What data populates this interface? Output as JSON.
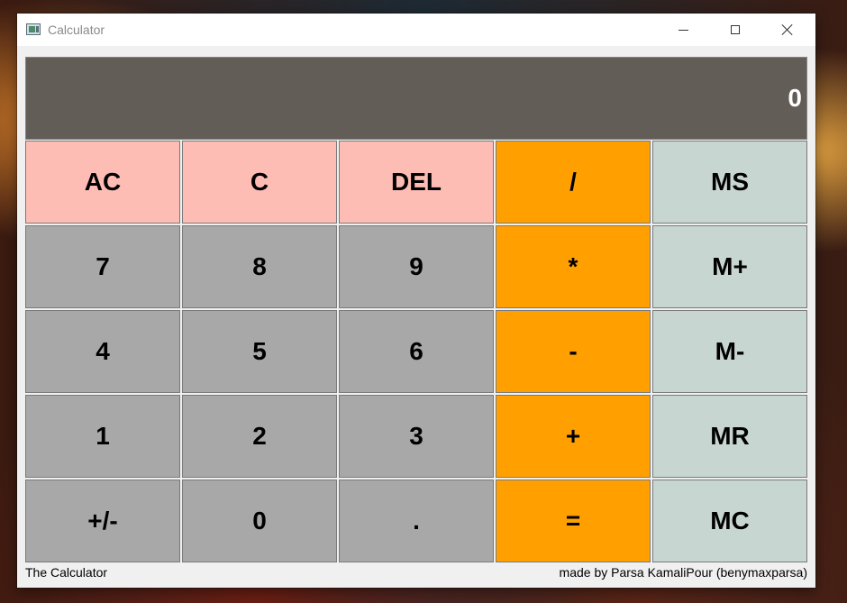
{
  "window": {
    "title": "Calculator"
  },
  "display": {
    "value": "0"
  },
  "keys": [
    {
      "label": "AC",
      "type": "clear",
      "name": "all-clear-button"
    },
    {
      "label": "C",
      "type": "clear",
      "name": "clear-button"
    },
    {
      "label": "DEL",
      "type": "clear",
      "name": "delete-button"
    },
    {
      "label": "/",
      "type": "op",
      "name": "divide-button"
    },
    {
      "label": "MS",
      "type": "mem",
      "name": "memory-store-button"
    },
    {
      "label": "7",
      "type": "num",
      "name": "digit-7-button"
    },
    {
      "label": "8",
      "type": "num",
      "name": "digit-8-button"
    },
    {
      "label": "9",
      "type": "num",
      "name": "digit-9-button"
    },
    {
      "label": "*",
      "type": "op",
      "name": "multiply-button"
    },
    {
      "label": "M+",
      "type": "mem",
      "name": "memory-add-button"
    },
    {
      "label": "4",
      "type": "num",
      "name": "digit-4-button"
    },
    {
      "label": "5",
      "type": "num",
      "name": "digit-5-button"
    },
    {
      "label": "6",
      "type": "num",
      "name": "digit-6-button"
    },
    {
      "label": "-",
      "type": "op",
      "name": "subtract-button"
    },
    {
      "label": "M-",
      "type": "mem",
      "name": "memory-subtract-button"
    },
    {
      "label": "1",
      "type": "num",
      "name": "digit-1-button"
    },
    {
      "label": "2",
      "type": "num",
      "name": "digit-2-button"
    },
    {
      "label": "3",
      "type": "num",
      "name": "digit-3-button"
    },
    {
      "label": "+",
      "type": "op",
      "name": "add-button"
    },
    {
      "label": "MR",
      "type": "mem",
      "name": "memory-recall-button"
    },
    {
      "label": "+/-",
      "type": "num",
      "name": "negate-button"
    },
    {
      "label": "0",
      "type": "num",
      "name": "digit-0-button"
    },
    {
      "label": ".",
      "type": "num",
      "name": "decimal-point-button"
    },
    {
      "label": "=",
      "type": "op",
      "name": "equals-button"
    },
    {
      "label": "MC",
      "type": "mem",
      "name": "memory-clear-button"
    }
  ],
  "footer": {
    "left": "The Calculator",
    "right": "made by Parsa KamaliPour (benymaxparsa)"
  },
  "colors": {
    "display_bg": "#635d57",
    "clear_key": "#fdbdb4",
    "number_key": "#a8a8a8",
    "operator_key": "#ffa000",
    "memory_key": "#c8d6d2"
  },
  "icons": [
    "app-icon",
    "minimize-icon",
    "maximize-icon",
    "close-icon"
  ]
}
